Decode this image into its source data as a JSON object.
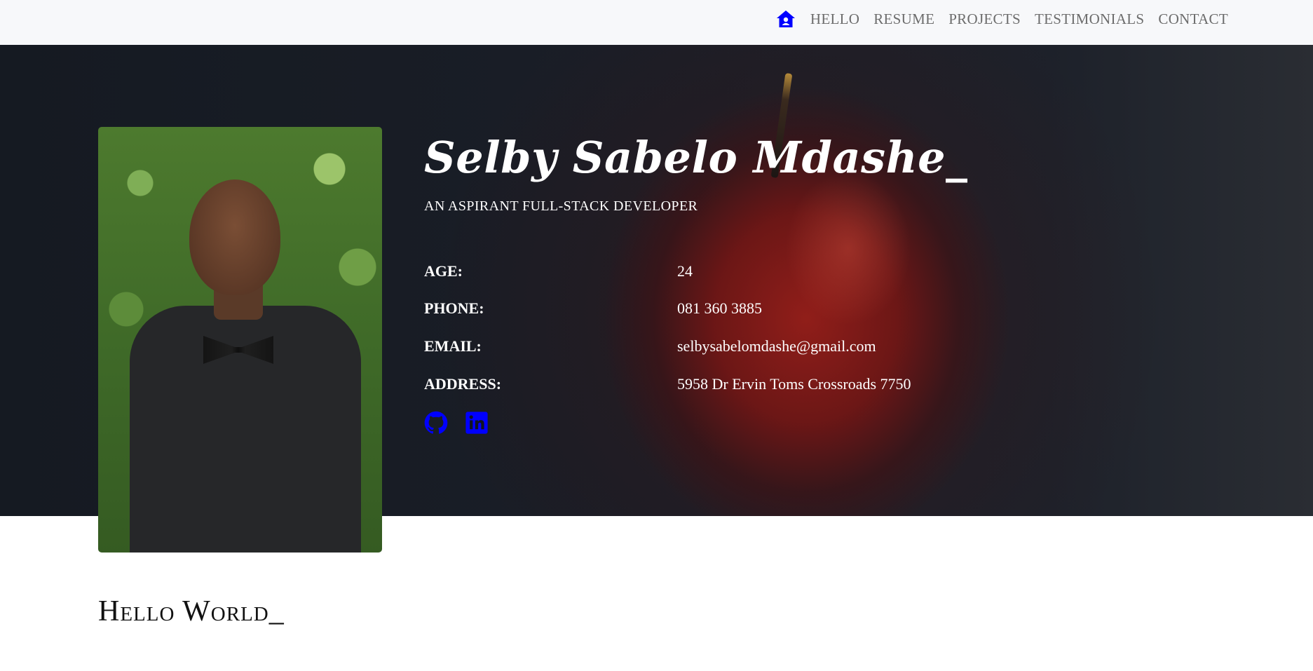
{
  "nav": {
    "home_icon": "home-icon",
    "items": [
      "HELLO",
      "RESUME",
      "PROJECTS",
      "TESTIMONIALS",
      "CONTACT"
    ]
  },
  "hero": {
    "name": "Selby Sabelo Mdashe_",
    "tagline": "AN ASPIRANT FULL-STACK DEVELOPER",
    "info": [
      {
        "label": "AGE:",
        "value": "24"
      },
      {
        "label": "PHONE:",
        "value": "081 360 3885"
      },
      {
        "label": "EMAIL:",
        "value": "selbysabelomdashe@gmail.com"
      },
      {
        "label": "ADDRESS:",
        "value": "5958 Dr Ervin Toms Crossroads 7750"
      }
    ],
    "social": [
      {
        "name": "github",
        "icon": "github-icon"
      },
      {
        "name": "linkedin",
        "icon": "linkedin-icon"
      }
    ]
  },
  "section": {
    "hello_title": "Hello World_"
  },
  "colors": {
    "accent": "#0000ff",
    "nav_bg": "#f7f8fa",
    "nav_text": "#6c6c6c",
    "hero_bg": "#181c24",
    "apple_red": "#8e1f1a"
  }
}
